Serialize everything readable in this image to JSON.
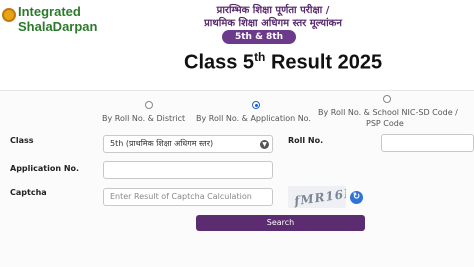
{
  "header": {
    "logo_line1": "Integrated",
    "logo_line2": "ShalaDarpan",
    "hindi_line1": "प्रारम्भिक शिक्षा पूर्णता परीक्षा /",
    "hindi_line2": "प्राथमिक शिक्षा अधिगम स्तर मूल्यांकन",
    "exam_badge": "5th & 8th Exam",
    "title_main": "Class 5",
    "title_sup": "th",
    "title_rest": " Result 2025"
  },
  "search_mode": {
    "options": [
      {
        "label": "By Roll No. & District",
        "selected": false
      },
      {
        "label": "By Roll No. & Application No.",
        "selected": true
      },
      {
        "label": "By Roll No. & School NIC-SD Code / PSP Code",
        "selected": false
      }
    ],
    "option3_line1": "By Roll No. & School NIC-SD Code /",
    "option3_line2": "PSP Code"
  },
  "form": {
    "class_label": "Class",
    "class_value": "5th (प्राथमिक शिक्षा अधिगम स्तर)",
    "roll_label": "Roll No.",
    "roll_value": "",
    "application_label": "Application No.",
    "application_value": "",
    "captcha_label": "Captcha",
    "captcha_placeholder": "Enter Result of Captcha Calculation",
    "captcha_text": "fMR16B",
    "search_label": "Search"
  },
  "icons": {
    "logo": "logo-gear-icon",
    "dropdown": "chevron-down-icon",
    "refresh": "refresh-icon"
  },
  "colors": {
    "brand_purple": "#5b2c6f",
    "logo_green": "#2d7a2d",
    "radio_blue": "#1e62c9"
  }
}
